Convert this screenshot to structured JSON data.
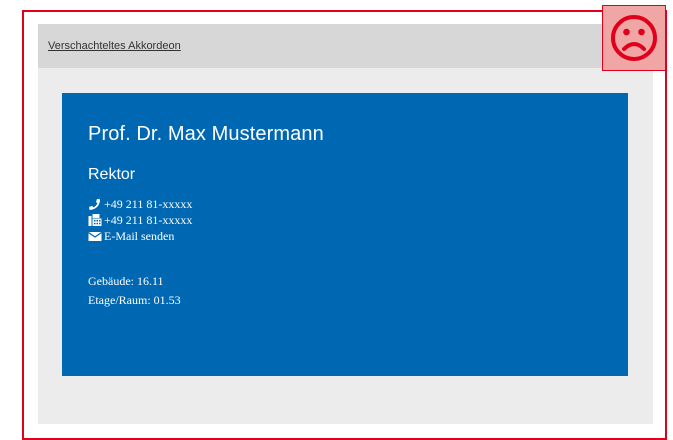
{
  "accordion": {
    "title": "Verschachteltes Akkordeon"
  },
  "contact_card": {
    "name": "Prof. Dr. Max Mustermann",
    "role": "Rektor",
    "phone": "+49 211 81-xxxxx",
    "fax": "+49 211 81-xxxxx",
    "email_label": "E-Mail senden",
    "building": "Gebäude: 16.11",
    "room": "Etage/Raum: 01.53",
    "icons": {
      "phone": "phone-icon",
      "fax": "fax-icon",
      "email": "envelope-icon"
    }
  },
  "status_indicator": {
    "icon": "sad-face-icon"
  },
  "colors": {
    "card_background": "#0068b3",
    "frame_border": "#e0001b",
    "indicator_background": "#f1a6a6",
    "header_background": "#d7d7d7",
    "panel_background": "#ececec"
  }
}
